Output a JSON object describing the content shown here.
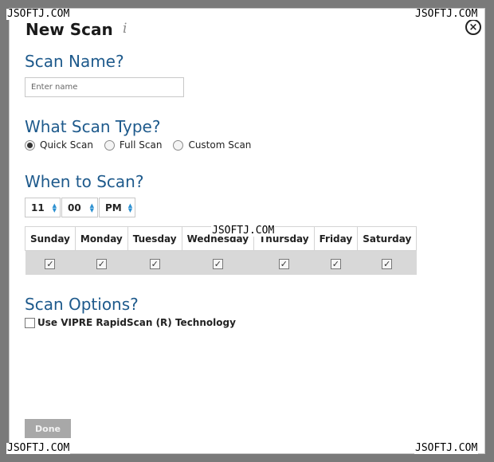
{
  "watermark": "JSOFTJ.COM",
  "dialog": {
    "title": "New Scan",
    "info_icon": "i",
    "close_icon": "×"
  },
  "scan_name": {
    "heading": "Scan Name?",
    "placeholder": "Enter name",
    "value": ""
  },
  "scan_type": {
    "heading": "What Scan Type?",
    "options": [
      {
        "label": "Quick Scan",
        "selected": true
      },
      {
        "label": "Full Scan",
        "selected": false
      },
      {
        "label": "Custom Scan",
        "selected": false
      }
    ]
  },
  "schedule": {
    "heading": "When to Scan?",
    "hour": "11",
    "minute": "00",
    "meridiem": "PM",
    "days": [
      {
        "label": "Sunday",
        "checked": true
      },
      {
        "label": "Monday",
        "checked": true
      },
      {
        "label": "Tuesday",
        "checked": true
      },
      {
        "label": "Wednesday",
        "checked": true
      },
      {
        "label": "Thursday",
        "checked": true
      },
      {
        "label": "Friday",
        "checked": true
      },
      {
        "label": "Saturday",
        "checked": true
      }
    ]
  },
  "scan_options": {
    "heading": "Scan Options?",
    "rapidscan_label": "Use VIPRE RapidScan (R) Technology",
    "rapidscan_checked": false
  },
  "footer": {
    "done_label": "Done"
  },
  "colors": {
    "heading": "#1e5a8c",
    "spinner_arrow": "#2a8fd0",
    "done_button": "#a8a8a8"
  }
}
